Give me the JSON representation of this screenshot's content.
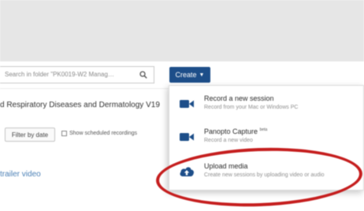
{
  "search": {
    "placeholder": "Search in folder \"PK0019-W2 Manag…"
  },
  "toolbar": {
    "create_label": "Create"
  },
  "folder": {
    "title": "d Respiratory Diseases and Dermatology V19",
    "filter_label": "Filter by date",
    "scheduled_label": "Show scheduled recordings"
  },
  "content": {
    "trailer_link": "trailer video"
  },
  "create_menu": {
    "items": [
      {
        "title": "Record a new session",
        "subtitle": "Record from your Mac or Windows PC",
        "icon": "video-camera-icon"
      },
      {
        "title": "Panopto Capture",
        "badge": "beta",
        "subtitle": "Record a new video",
        "icon": "video-camera-icon"
      },
      {
        "title": "Upload media",
        "subtitle": "Create new sessions by uploading video or audio",
        "icon": "cloud-upload-icon"
      }
    ]
  },
  "colors": {
    "create_button": "#1d4e89",
    "icon": "#1d4e89",
    "annotation": "#c51e1e",
    "link": "#4a7fb5"
  }
}
